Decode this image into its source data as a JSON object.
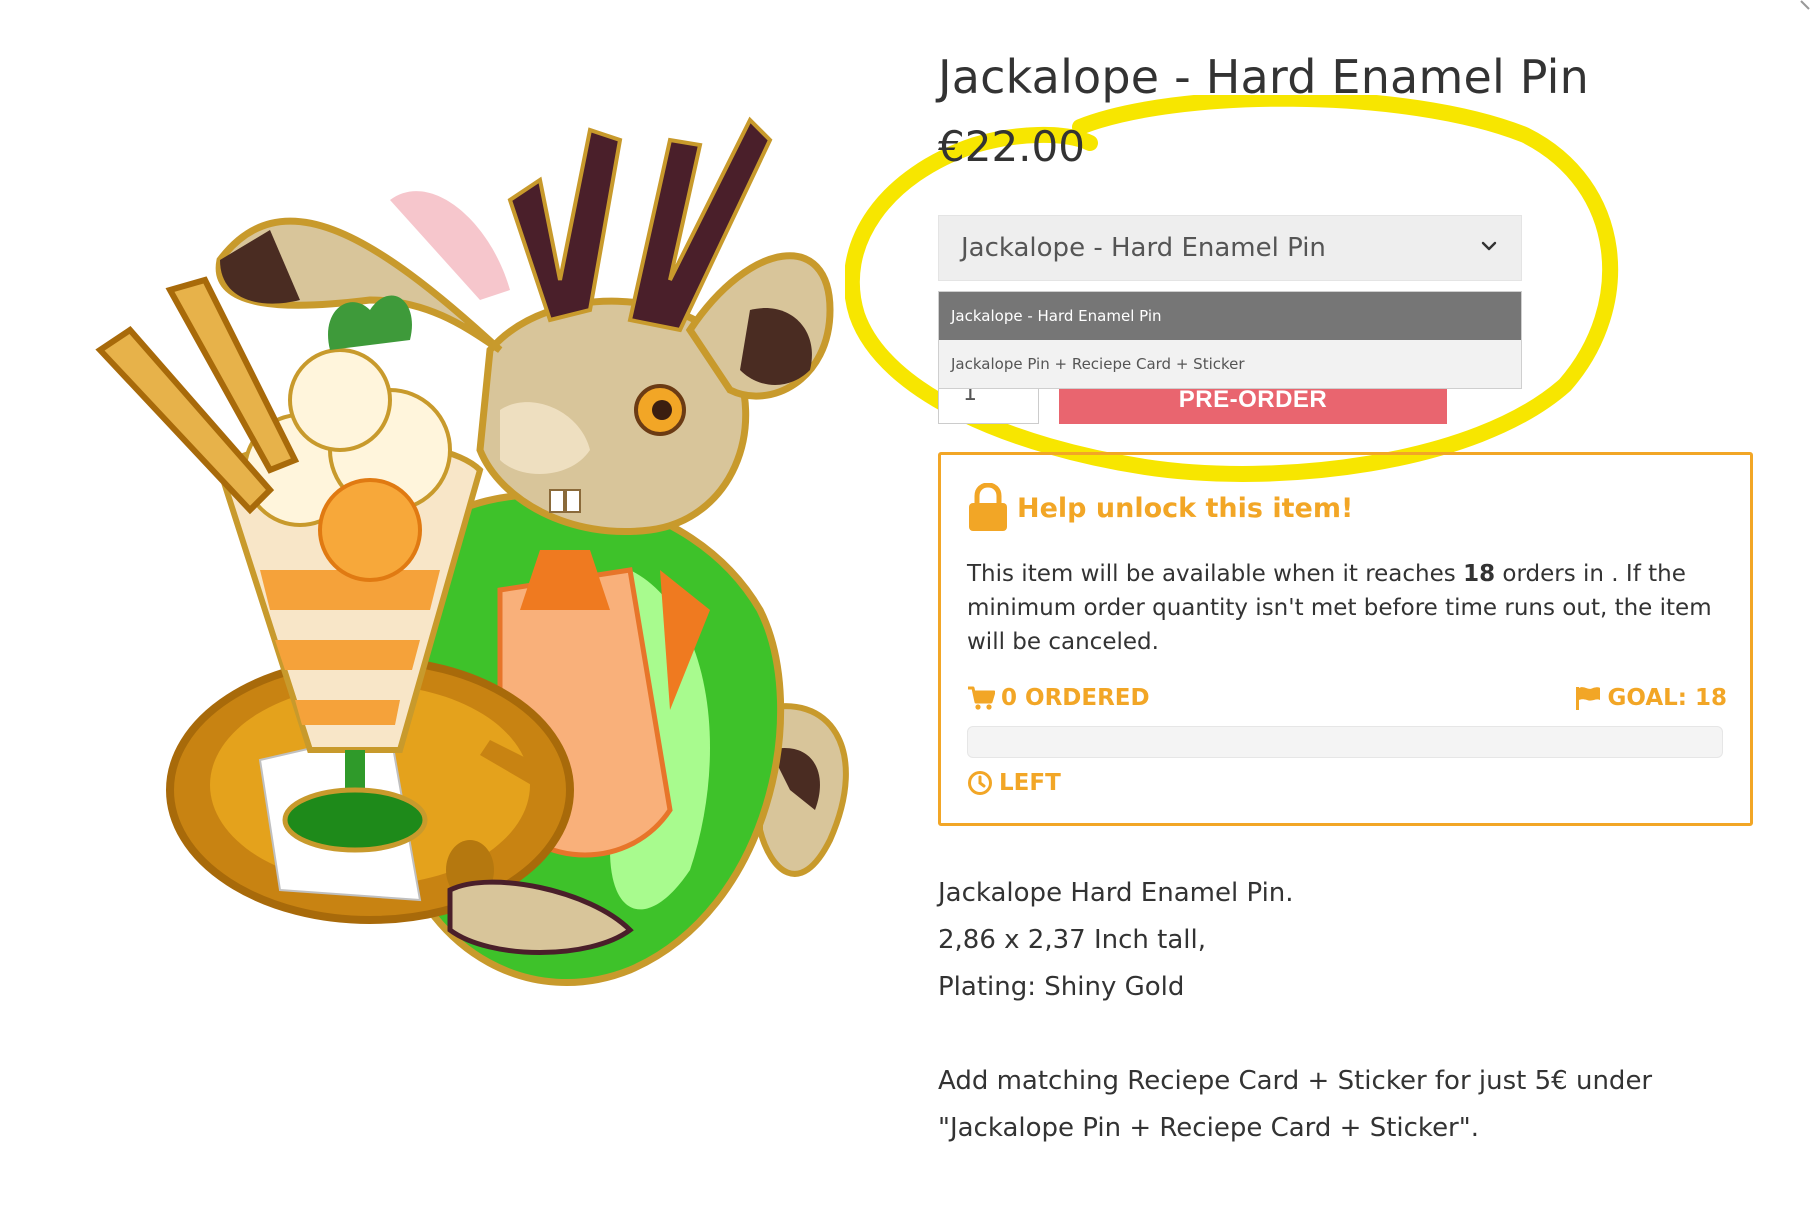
{
  "product": {
    "title": "Jackalope - Hard Enamel Pin",
    "price": "€22.00",
    "image_alt": "jackalope-barista-pin-illustration"
  },
  "variant": {
    "selected": "Jackalope - Hard Enamel Pin",
    "options": [
      "Jackalope - Hard Enamel Pin",
      "Jackalope Pin + Reciepe Card + Sticker"
    ]
  },
  "purchase": {
    "quantity": "1",
    "button_label": "PRE-ORDER"
  },
  "unlock": {
    "heading": "Help unlock this item!",
    "text_before": "This item will be available when it reaches ",
    "goal_number": "18",
    "text_after": " orders in . If the minimum order quantity isn't met before time runs out, the item will be canceled.",
    "ordered_label": "0 ORDERED",
    "goal_label": "GOAL: 18",
    "left_label": "LEFT",
    "progress": 0
  },
  "description": {
    "line1": "Jackalope Hard Enamel Pin.",
    "line2": "2,86 x 2,37 Inch tall,",
    "line3": "Plating: Shiny Gold",
    "line4": "Add matching Reciepe Card + Sticker for just 5€ under",
    "line5": "\"Jackalope Pin + Reciepe Card + Sticker\"."
  },
  "colors": {
    "accent_orange": "#f2a626",
    "preorder_red": "#e9656f",
    "highlight_yellow": "#f7e600",
    "dropdown_active": "#767676"
  },
  "icons": {
    "lock": "lock-icon",
    "cart": "cart-icon",
    "flag": "flag-icon",
    "clock": "clock-icon",
    "chevron": "chevron-down-icon"
  }
}
